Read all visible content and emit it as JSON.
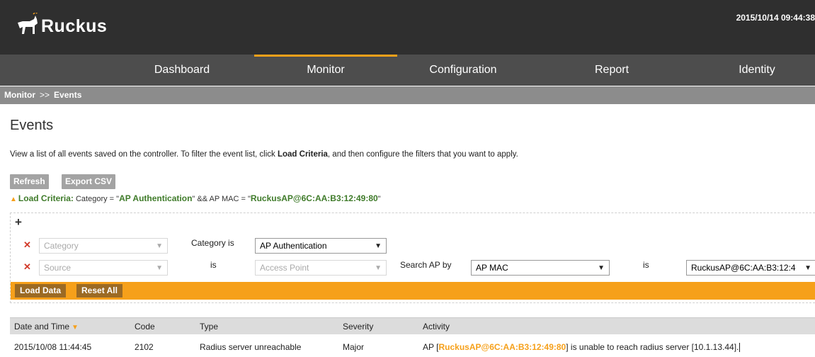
{
  "header": {
    "logo_text": "Ruckus",
    "datetime": "2015/10/14 09:44:38"
  },
  "nav": {
    "items": [
      {
        "label": "Dashboard"
      },
      {
        "label": "Monitor"
      },
      {
        "label": "Configuration"
      },
      {
        "label": "Report"
      },
      {
        "label": "Identity"
      }
    ],
    "active": "Monitor"
  },
  "breadcrumb": {
    "parent": "Monitor",
    "separator": ">>",
    "current": "Events"
  },
  "page": {
    "title": "Events",
    "description_prefix": "View a list of all events saved on the controller. To filter the event list, click ",
    "description_bold": "Load Criteria",
    "description_suffix": ", and then configure the filters that you want to apply."
  },
  "toolbar": {
    "refresh_label": "Refresh",
    "export_label": "Export CSV"
  },
  "criteria": {
    "label": "Load Criteria:",
    "part1": " Category = \"",
    "category_value": "AP Authentication",
    "part2": "\" && AP MAC = \"",
    "mac_value": "RuckusAP@6C:AA:B3:12:49:80",
    "part3": "\""
  },
  "filters": {
    "add_symbol": "+",
    "remove_symbol": "✕",
    "row1": {
      "field_placeholder": "Category",
      "operator_label": "Category is",
      "value": "AP Authentication"
    },
    "row2": {
      "field_placeholder": "Source",
      "operator_label": "is",
      "value_placeholder": "Access Point",
      "search_by_label": "Search AP by",
      "search_by_value": "AP MAC",
      "is_label": "is",
      "ap_value": "RuckusAP@6C:AA:B3:12:4"
    },
    "load_data_label": "Load Data",
    "reset_all_label": "Reset All"
  },
  "table": {
    "columns": [
      "Date and Time",
      "Code",
      "Type",
      "Severity",
      "Activity"
    ],
    "sort_column": "Date and Time",
    "rows": [
      {
        "date": "2015/10/08 11:44:45",
        "code": "2102",
        "type": "Radius server unreachable",
        "severity": "Major",
        "activity_prefix": "AP [",
        "activity_ap": "RuckusAP@6C:AA:B3:12:49:80",
        "activity_suffix": "] is unable to reach radius server [10.1.13.44]."
      }
    ]
  },
  "colors": {
    "accent": "#f6a01a",
    "header_bg": "#2f2f2f",
    "nav_bg": "#4d4d4d",
    "breadcrumb_bg": "#8c8c8c",
    "criteria_green": "#3f7b2a",
    "remove_red": "#d23a2a"
  }
}
